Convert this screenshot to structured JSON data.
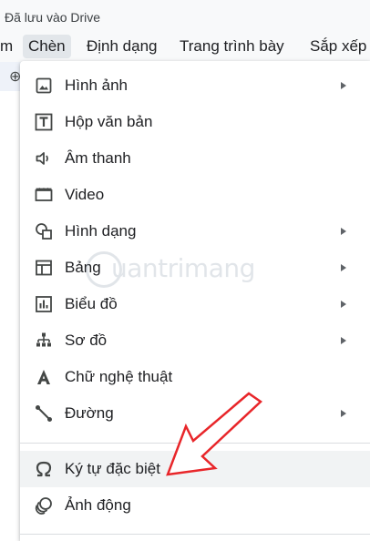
{
  "header": {
    "saved_status": "Đã lưu vào Drive"
  },
  "menubar": {
    "items": [
      {
        "label": "m"
      },
      {
        "label": "Chèn"
      },
      {
        "label": "Định dạng"
      },
      {
        "label": "Trang trình bày"
      },
      {
        "label": "Sắp xếp"
      }
    ],
    "active": "Chèn"
  },
  "insert_menu": {
    "items": [
      {
        "label": "Hình ảnh",
        "icon": "image-icon",
        "has_submenu": true
      },
      {
        "label": "Hộp văn bản",
        "icon": "text-box-icon",
        "has_submenu": false
      },
      {
        "label": "Âm thanh",
        "icon": "audio-icon",
        "has_submenu": false
      },
      {
        "label": "Video",
        "icon": "video-icon",
        "has_submenu": false
      },
      {
        "label": "Hình dạng",
        "icon": "shapes-icon",
        "has_submenu": true
      },
      {
        "label": "Bảng",
        "icon": "table-icon",
        "has_submenu": true
      },
      {
        "label": "Biểu đồ",
        "icon": "chart-icon",
        "has_submenu": true
      },
      {
        "label": "Sơ đồ",
        "icon": "diagram-icon",
        "has_submenu": true
      },
      {
        "label": "Chữ nghệ thuật",
        "icon": "word-art-icon",
        "has_submenu": false
      },
      {
        "label": "Đường",
        "icon": "line-icon",
        "has_submenu": true
      },
      {
        "label": "Ký tự đặc biệt",
        "icon": "omega-icon",
        "has_submenu": false
      },
      {
        "label": "Ảnh động",
        "icon": "animation-icon",
        "has_submenu": false
      }
    ],
    "highlighted": "Ký tự đặc biệt"
  },
  "colors": {
    "annotation_arrow": "#e8262a",
    "highlight": "#f1f3f4",
    "icon": "#444746"
  }
}
